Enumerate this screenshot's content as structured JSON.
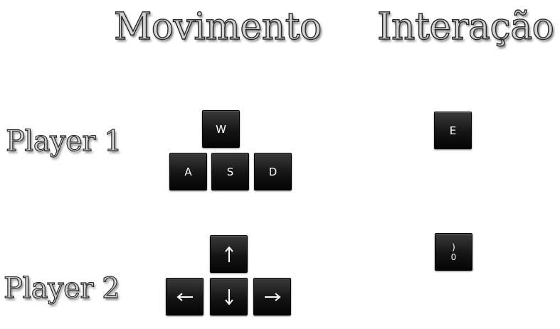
{
  "headers": {
    "movement": "Movimento",
    "interaction": "Interação"
  },
  "players": [
    {
      "label": "Player 1",
      "movement_keys": {
        "up": "W",
        "left": "A",
        "down": "S",
        "right": "D"
      },
      "interaction_key": "E"
    },
    {
      "label": "Player 2",
      "movement_keys": {
        "up": "arrow-up-icon",
        "left": "arrow-left-icon",
        "down": "arrow-down-icon",
        "right": "arrow-right-icon"
      },
      "interaction_key": {
        "top": ")",
        "bottom": "0"
      }
    }
  ],
  "colors": {
    "key_face": "#141414",
    "key_text": "#ffffff",
    "heading_fill": "#d2d2d2",
    "heading_outline": "#2a2a2a",
    "background": "#ffffff"
  }
}
